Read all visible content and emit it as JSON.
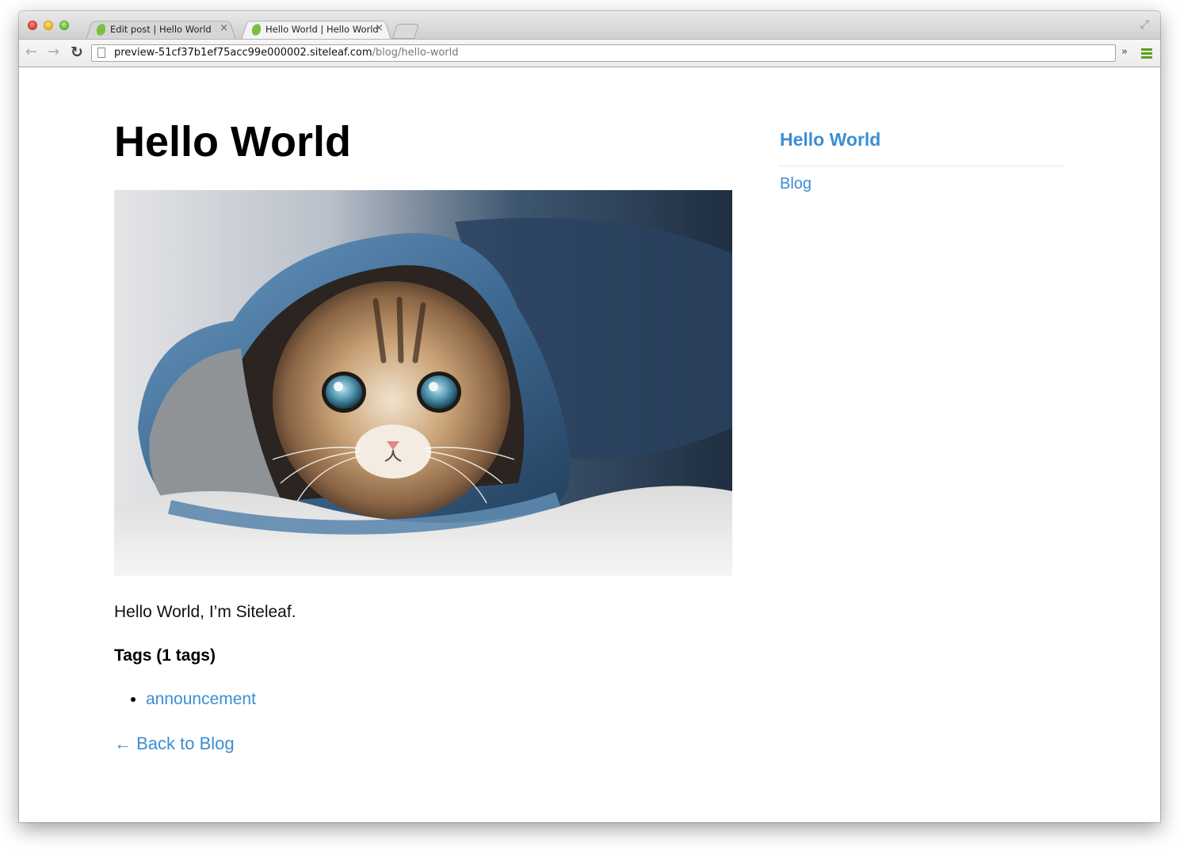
{
  "browser": {
    "tabs": [
      {
        "title": "Edit post | Hello World",
        "close": "×",
        "active": false
      },
      {
        "title": "Hello World | Hello World",
        "close": "×",
        "active": true
      }
    ],
    "nav": {
      "back": "←",
      "forward": "→",
      "reload": "↻"
    },
    "url": {
      "host": "preview-51cf37b1ef75acc99e000002.siteleaf.com",
      "path": "/blog/hello-world"
    },
    "extensions_chevron": "»",
    "fullscreen": "⤢"
  },
  "post": {
    "title": "Hello World",
    "image_alt": "Kitten peeking out of a denim pant leg",
    "body": "Hello World, I’m Siteleaf.",
    "tags_heading": "Tags (1 tags)",
    "tags": [
      "announcement"
    ],
    "back_link": "← Back to Blog"
  },
  "sidebar": {
    "site_title": "Hello World",
    "nav": [
      "Blog"
    ]
  },
  "colors": {
    "link": "#3b8ed4",
    "favicon": "#7cc043",
    "menu": "#5aa01d"
  }
}
